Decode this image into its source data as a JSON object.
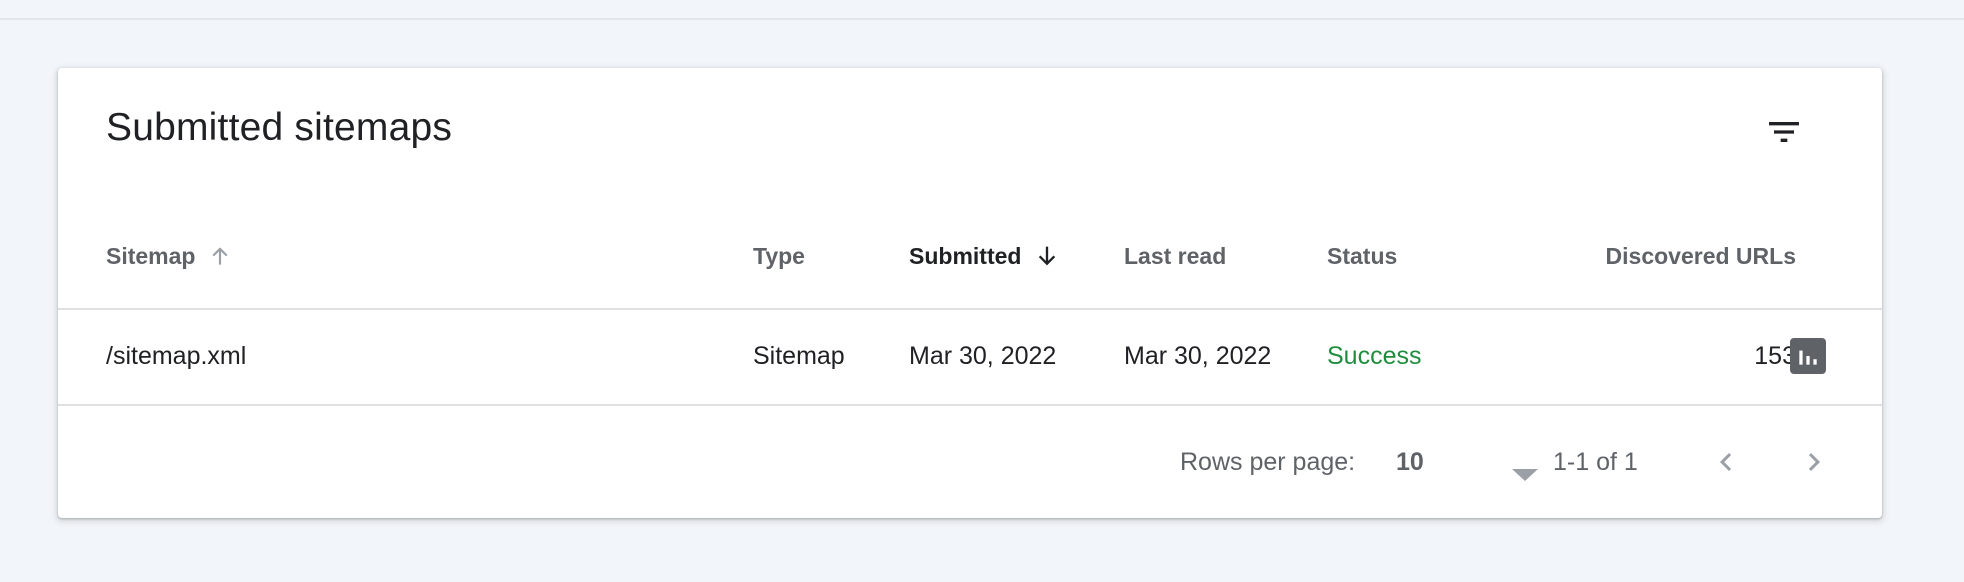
{
  "card": {
    "title": "Submitted sitemaps",
    "filter_icon": "filter-list-icon"
  },
  "table": {
    "columns": [
      {
        "label": "Sitemap",
        "sort": "ascending",
        "active": false
      },
      {
        "label": "Type"
      },
      {
        "label": "Submitted",
        "sort": "descending",
        "active": true
      },
      {
        "label": "Last read"
      },
      {
        "label": "Status"
      },
      {
        "label": "Discovered URLs"
      }
    ],
    "rows": [
      {
        "sitemap": "/sitemap.xml",
        "type": "Sitemap",
        "submitted": "Mar 30, 2022",
        "last_read": "Mar 30, 2022",
        "status": "Success",
        "discovered_urls": "153",
        "report_icon": "bar-chart-icon"
      }
    ]
  },
  "pagination": {
    "rows_per_page_label": "Rows per page:",
    "rows_per_page_value": "10",
    "range_text": "1-1 of 1",
    "prev_icon": "chevron-left-icon",
    "next_icon": "chevron-right-icon"
  },
  "colors": {
    "background": "#f2f5f9",
    "status_success": "#1e8e3e",
    "header_text": "#5f6368",
    "active_header_text": "#202124"
  }
}
